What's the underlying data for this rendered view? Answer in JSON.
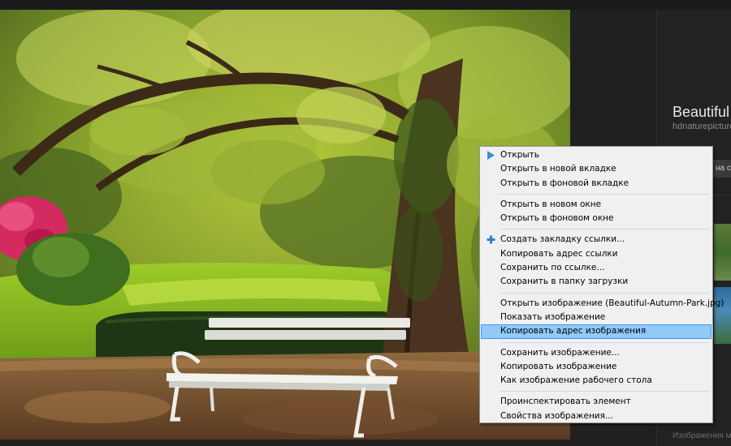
{
  "side_panel": {
    "title": "Beautiful",
    "source": "hdnaturepicture",
    "button_label": "на ст",
    "footer": "Изображения мо"
  },
  "context_menu": {
    "groups": [
      [
        {
          "label": "Открыть",
          "icon": "play-triangle-icon"
        },
        {
          "label": "Открыть в новой вкладке"
        },
        {
          "label": "Открыть в фоновой вкладке"
        }
      ],
      [
        {
          "label": "Открыть в новом окне"
        },
        {
          "label": "Открыть в фоновом окне"
        }
      ],
      [
        {
          "label": "Создать закладку ссылки...",
          "icon": "plus-icon"
        },
        {
          "label": "Копировать адрес ссылки"
        },
        {
          "label": "Сохранить по ссылке..."
        },
        {
          "label": "Сохранить в папку загрузки"
        }
      ],
      [
        {
          "label": "Открыть изображение (Beautiful-Autumn-Park.jpg)"
        },
        {
          "label": "Показать изображение"
        },
        {
          "label": "Копировать адрес изображения",
          "highlighted": true
        }
      ],
      [
        {
          "label": "Сохранить изображение..."
        },
        {
          "label": "Копировать изображение"
        },
        {
          "label": "Как изображение рабочего стола"
        }
      ],
      [
        {
          "label": "Проинспектировать элемент"
        },
        {
          "label": "Свойства изображения..."
        }
      ]
    ],
    "colors": {
      "background": "#f0f0f0",
      "highlight": "#91c9f7",
      "highlight_border": "#3399ff",
      "play_icon": "#3a8fd8",
      "plus_icon": "#2f7fd0"
    }
  }
}
